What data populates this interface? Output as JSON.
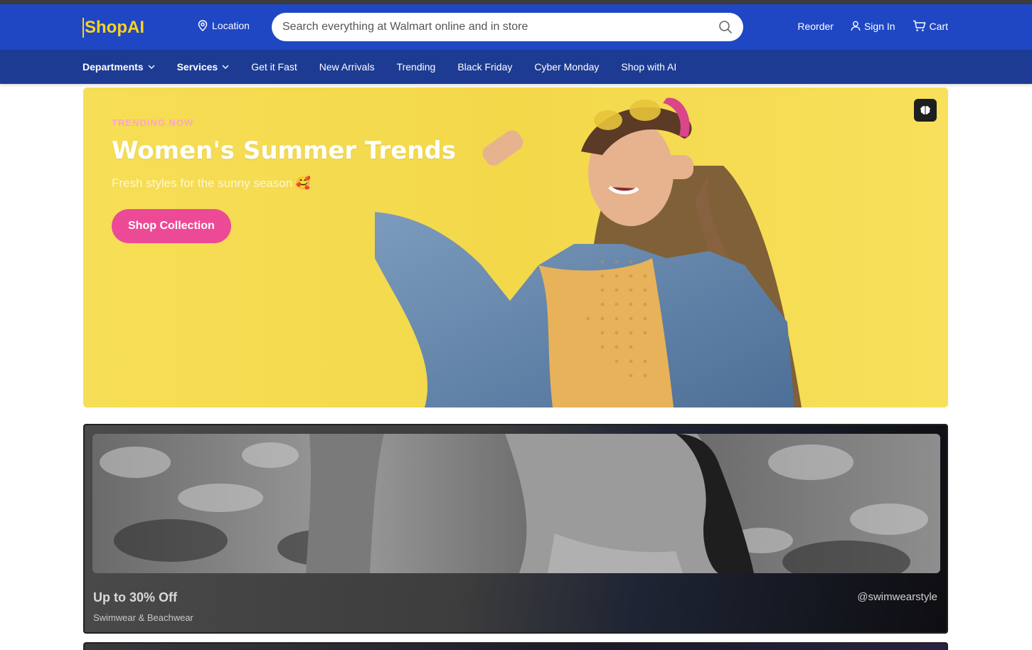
{
  "header": {
    "logo": "ShopAI",
    "location_label": "Location",
    "search_placeholder": "Search everything at Walmart online and in store",
    "reorder_label": "Reorder",
    "signin_label": "Sign In",
    "cart_label": "Cart"
  },
  "nav": {
    "items": [
      {
        "label": "Departments",
        "dropdown": true
      },
      {
        "label": "Services",
        "dropdown": true
      },
      {
        "label": "Get it Fast"
      },
      {
        "label": "New Arrivals"
      },
      {
        "label": "Trending"
      },
      {
        "label": "Black Friday"
      },
      {
        "label": "Cyber Monday"
      },
      {
        "label": "Shop with AI"
      }
    ]
  },
  "hero": {
    "eyebrow": "TRENDING NOW",
    "title": "Women's Summer Trends",
    "subtitle": "Fresh styles for the sunny season",
    "emoji": "🥰",
    "cta_label": "Shop Collection",
    "badge_icon": "brain-icon"
  },
  "promo": {
    "title": "Up to 30% Off",
    "subtitle": "Swimwear & Beachwear",
    "handle": "@swimwearstyle"
  },
  "colors": {
    "header_bg": "#1f47c4",
    "nav_bg": "#1d3b93",
    "logo": "#ffd21f",
    "hero_bg": "#f6dc4a",
    "cta": "#ec4a97"
  }
}
